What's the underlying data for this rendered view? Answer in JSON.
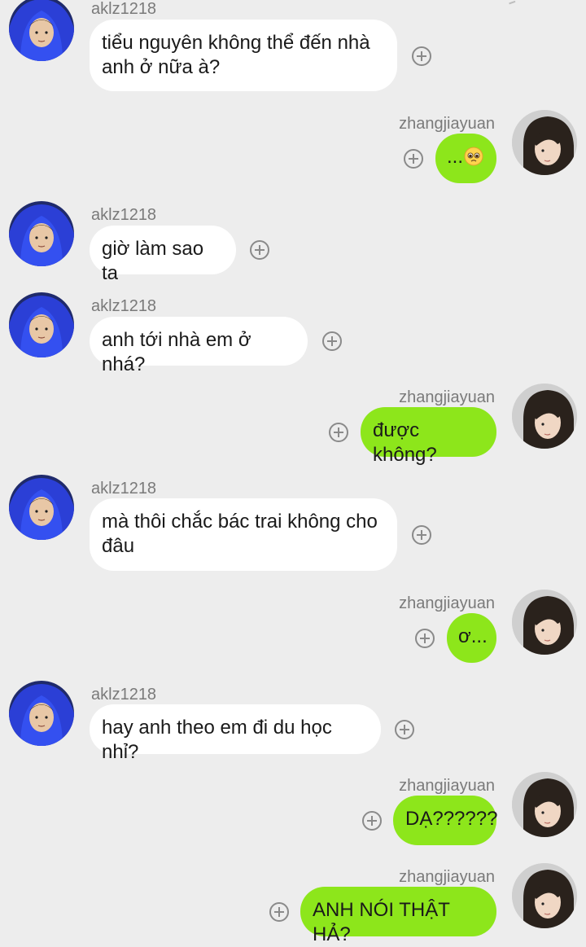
{
  "messages": [
    {
      "side": "left",
      "sender": "aklz1218",
      "lines": [
        "tiểu nguyên không thể đến nhà",
        "anh ở nữa à?"
      ]
    },
    {
      "side": "right",
      "sender": "zhangjiayuan",
      "lines": [
        "..."
      ],
      "emoji": "pleading-face-emoji"
    },
    {
      "side": "left",
      "sender": "aklz1218",
      "lines": [
        "giờ làm sao ta"
      ]
    },
    {
      "side": "left",
      "sender": "aklz1218",
      "lines": [
        "anh tới nhà em ở nhá?"
      ]
    },
    {
      "side": "right",
      "sender": "zhangjiayuan",
      "lines": [
        "được không?"
      ]
    },
    {
      "side": "left",
      "sender": "aklz1218",
      "lines": [
        "mà thôi chắc bác trai không cho",
        "đâu"
      ]
    },
    {
      "side": "right",
      "sender": "zhangjiayuan",
      "lines": [
        "ơ..."
      ]
    },
    {
      "side": "left",
      "sender": "aklz1218",
      "lines": [
        "hay anh theo em đi du học nhỉ?"
      ]
    },
    {
      "side": "right",
      "sender": "zhangjiayuan",
      "lines": [
        "DẠ??????"
      ]
    },
    {
      "side": "right",
      "sender": "zhangjiayuan",
      "lines": [
        "ANH NÓI THẬT HẢ?"
      ]
    }
  ],
  "icons": {
    "add_reaction": "add-reaction-plus-icon",
    "left_avatar": "blue-hoodie-avatar",
    "right_avatar": "dark-hair-avatar"
  },
  "colors": {
    "background": "#ededed",
    "incoming_bubble": "#ffffff",
    "outgoing_bubble": "#8de61b",
    "sender_text": "#7a7a7a"
  }
}
